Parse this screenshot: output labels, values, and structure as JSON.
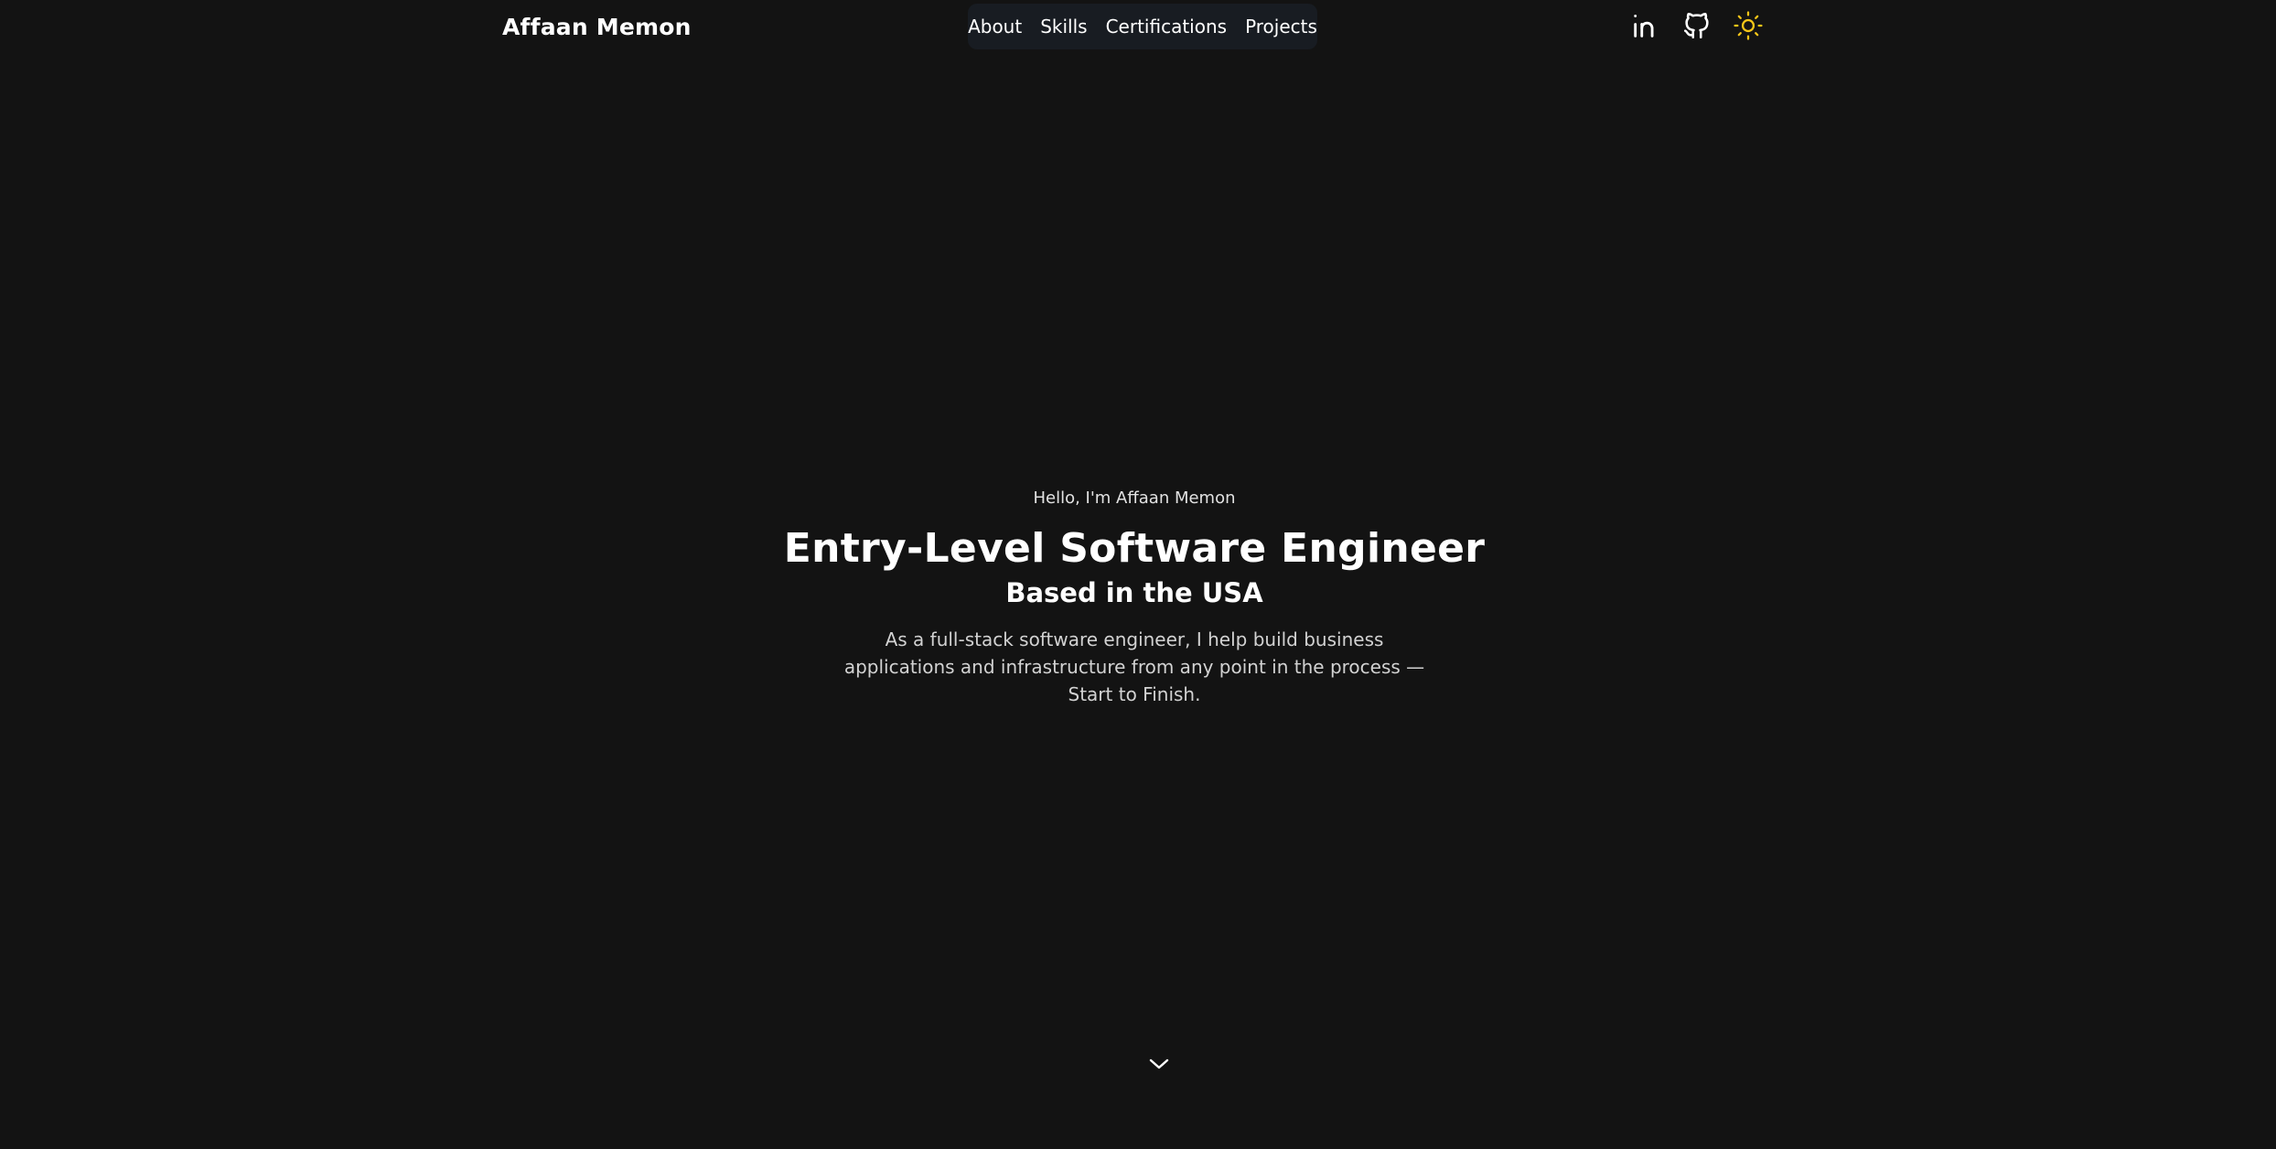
{
  "header": {
    "brand": "Affaan Memon",
    "nav": {
      "about": "About",
      "skills": "Skills",
      "certifications": "Certifications",
      "projects": "Projects"
    },
    "icons": [
      "linkedin-icon",
      "github-icon",
      "sun-icon"
    ]
  },
  "hero": {
    "greeting": "Hello, I'm Affaan Memon",
    "title": "Entry-Level Software Engineer",
    "subtitle": "Based in the USA",
    "description": "As a full-stack software engineer, I help build business applications and infrastructure from any point in the process — Start to Finish."
  },
  "scroll": {
    "icon": "chevron-down-icon"
  },
  "colors": {
    "background": "#131313",
    "nav_background": "#181c22",
    "text": "#ffffff",
    "muted_text": "#d2d2d2",
    "sun_accent": "#f5c518"
  }
}
